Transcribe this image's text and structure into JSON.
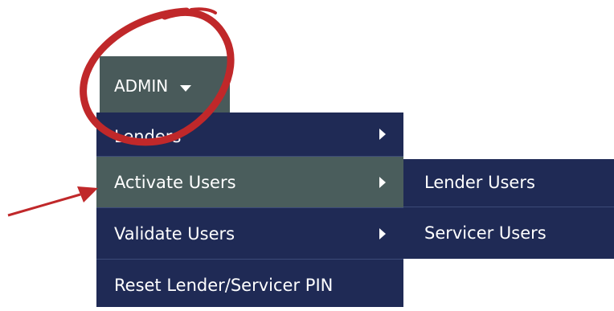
{
  "admin_menu": {
    "label": "ADMIN",
    "caret_icon": "caret-down-icon",
    "items": [
      {
        "label": "Lenders",
        "has_submenu": true
      },
      {
        "label": "Activate Users",
        "has_submenu": true,
        "active": true
      },
      {
        "label": "Validate Users",
        "has_submenu": true
      },
      {
        "label": "Reset Lender/Servicer PIN",
        "has_submenu": false
      }
    ],
    "submenu": [
      {
        "label": "Lender Users"
      },
      {
        "label": "Servicer Users"
      }
    ]
  },
  "annotations": {
    "circle_color": "#c0282a",
    "arrow_color": "#c0282a"
  },
  "colors": {
    "menu_bg": "#1f2a55",
    "active_bg": "#4a5d5c",
    "admin_bg": "#495a5a"
  }
}
